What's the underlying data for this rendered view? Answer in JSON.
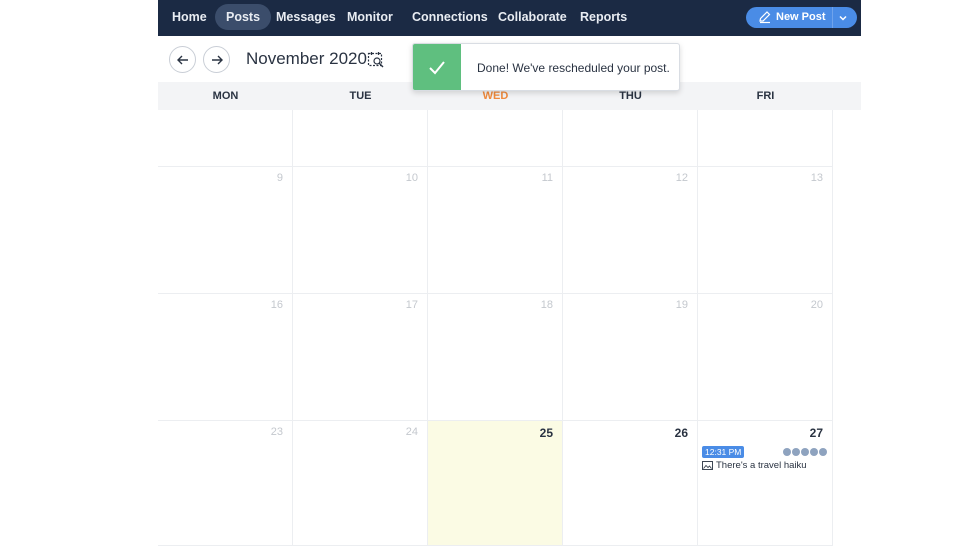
{
  "nav": {
    "items": [
      {
        "label": "Home",
        "active": false
      },
      {
        "label": "Posts",
        "active": true
      },
      {
        "label": "Messages",
        "active": false
      },
      {
        "label": "Monitor",
        "active": false
      },
      {
        "label": "Connections",
        "active": false
      },
      {
        "label": "Collaborate",
        "active": false
      },
      {
        "label": "Reports",
        "active": false
      }
    ],
    "new_post_label": "New Post"
  },
  "toolbar": {
    "prev_icon": "arrow-left-icon",
    "next_icon": "arrow-right-icon",
    "month_title": "November 2020",
    "calendar_search_icon": "calendar-search-icon"
  },
  "toast": {
    "icon": "check-icon",
    "message": "Done! We've rescheduled your post."
  },
  "calendar": {
    "weekdays": [
      {
        "label": "MON",
        "today": false
      },
      {
        "label": "TUE",
        "today": false
      },
      {
        "label": "WED",
        "today": true
      },
      {
        "label": "THU",
        "today": false
      },
      {
        "label": "FRI",
        "today": false
      }
    ],
    "weeks": [
      [
        "",
        "",
        "",
        "",
        ""
      ],
      [
        "9",
        "10",
        "11",
        "12",
        "13"
      ],
      [
        "16",
        "17",
        "18",
        "19",
        "20"
      ],
      [
        "23",
        "24",
        "25",
        "26",
        "27"
      ]
    ],
    "highlight_days": [
      "25",
      "26",
      "27"
    ],
    "today_day": "25"
  },
  "post": {
    "day": "27",
    "time": "12:31 PM",
    "title": "There's a travel haiku",
    "networks": [
      "facebook-icon",
      "twitter-icon",
      "instagram-icon",
      "linkedin-icon",
      "youtube-icon"
    ]
  },
  "colors": {
    "nav_bg": "#1b2a44",
    "accent": "#4a8ce6",
    "success": "#5fbf7f",
    "today_header": "#f08a3c",
    "today_cell": "#fbfbe4"
  }
}
